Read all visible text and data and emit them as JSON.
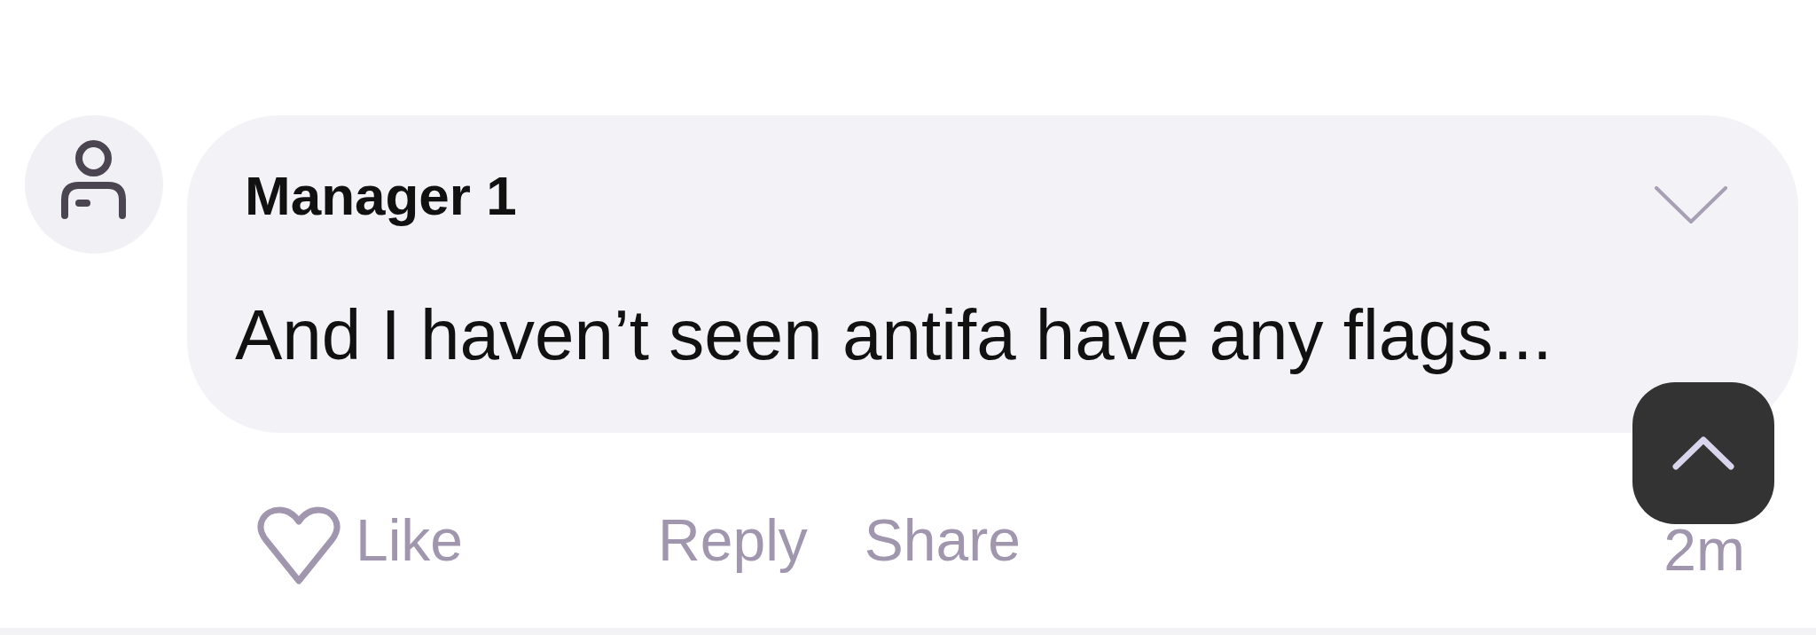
{
  "comment": {
    "author": "Manager 1",
    "text": "And I haven’t seen antifa have any flags...",
    "liked": false,
    "actions": [
      {
        "kind": "like",
        "label": "Like"
      },
      {
        "kind": "reply",
        "label": "Reply"
      },
      {
        "kind": "share",
        "label": "Share"
      }
    ],
    "time": "2m"
  }
}
